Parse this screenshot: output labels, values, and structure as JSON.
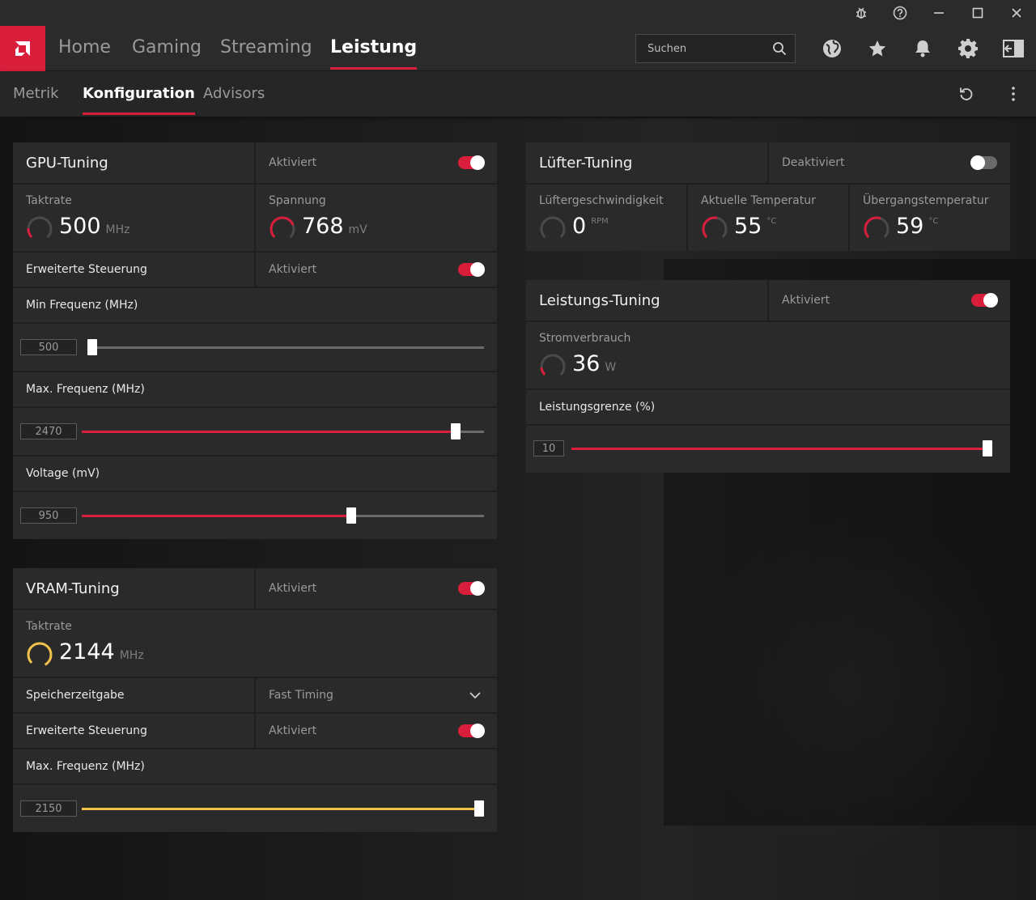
{
  "nav": {
    "items": [
      "Home",
      "Gaming",
      "Streaming",
      "Leistung"
    ],
    "search_placeholder": "Suchen"
  },
  "subnav": {
    "items": [
      "Metrik",
      "Konfiguration",
      "Advisors"
    ]
  },
  "colors": {
    "accent": "#d81e3a",
    "vram": "#f0c24a"
  },
  "gpu_tuning": {
    "title": "GPU-Tuning",
    "status": "Aktiviert",
    "enabled": true,
    "clock_label": "Taktrate",
    "clock_value": "500",
    "clock_unit": "MHz",
    "voltage_label": "Spannung",
    "voltage_value": "768",
    "voltage_unit": "mV",
    "advanced_label": "Erweiterte Steuerung",
    "advanced_status": "Aktiviert",
    "min_freq_label": "Min Frequenz (MHz)",
    "min_freq_value": "500",
    "min_freq_fraction": 0.0,
    "max_freq_label": "Max. Frequenz (MHz)",
    "max_freq_value": "2470",
    "max_freq_fraction": 0.93,
    "voltage_slider_label": "Voltage (mV)",
    "voltage_slider_value": "950",
    "voltage_slider_fraction": 0.67
  },
  "vram_tuning": {
    "title": "VRAM-Tuning",
    "status": "Aktiviert",
    "enabled": true,
    "clock_label": "Taktrate",
    "clock_value": "2144",
    "clock_unit": "MHz",
    "timing_label": "Speicherzeitgabe",
    "timing_value": "Fast Timing",
    "advanced_label": "Erweiterte Steuerung",
    "advanced_status": "Aktiviert",
    "max_freq_label": "Max. Frequenz (MHz)",
    "max_freq_value": "2150",
    "max_freq_fraction": 1.0
  },
  "fan_tuning": {
    "title": "Lüfter-Tuning",
    "status": "Deaktiviert",
    "enabled": false,
    "speed_label": "Lüftergeschwindigkeit",
    "speed_value": "0",
    "speed_unit": "RPM",
    "temp_label": "Aktuelle Temperatur",
    "temp_value": "55",
    "temp_unit": "°C",
    "junction_label": "Übergangstemperatur",
    "junction_value": "59",
    "junction_unit": "°C"
  },
  "power_tuning": {
    "title": "Leistungs-Tuning",
    "status": "Aktiviert",
    "enabled": true,
    "power_label": "Stromverbrauch",
    "power_value": "36",
    "power_unit": "W",
    "limit_label": "Leistungsgrenze (%)",
    "limit_value": "10",
    "limit_fraction": 1.0
  }
}
